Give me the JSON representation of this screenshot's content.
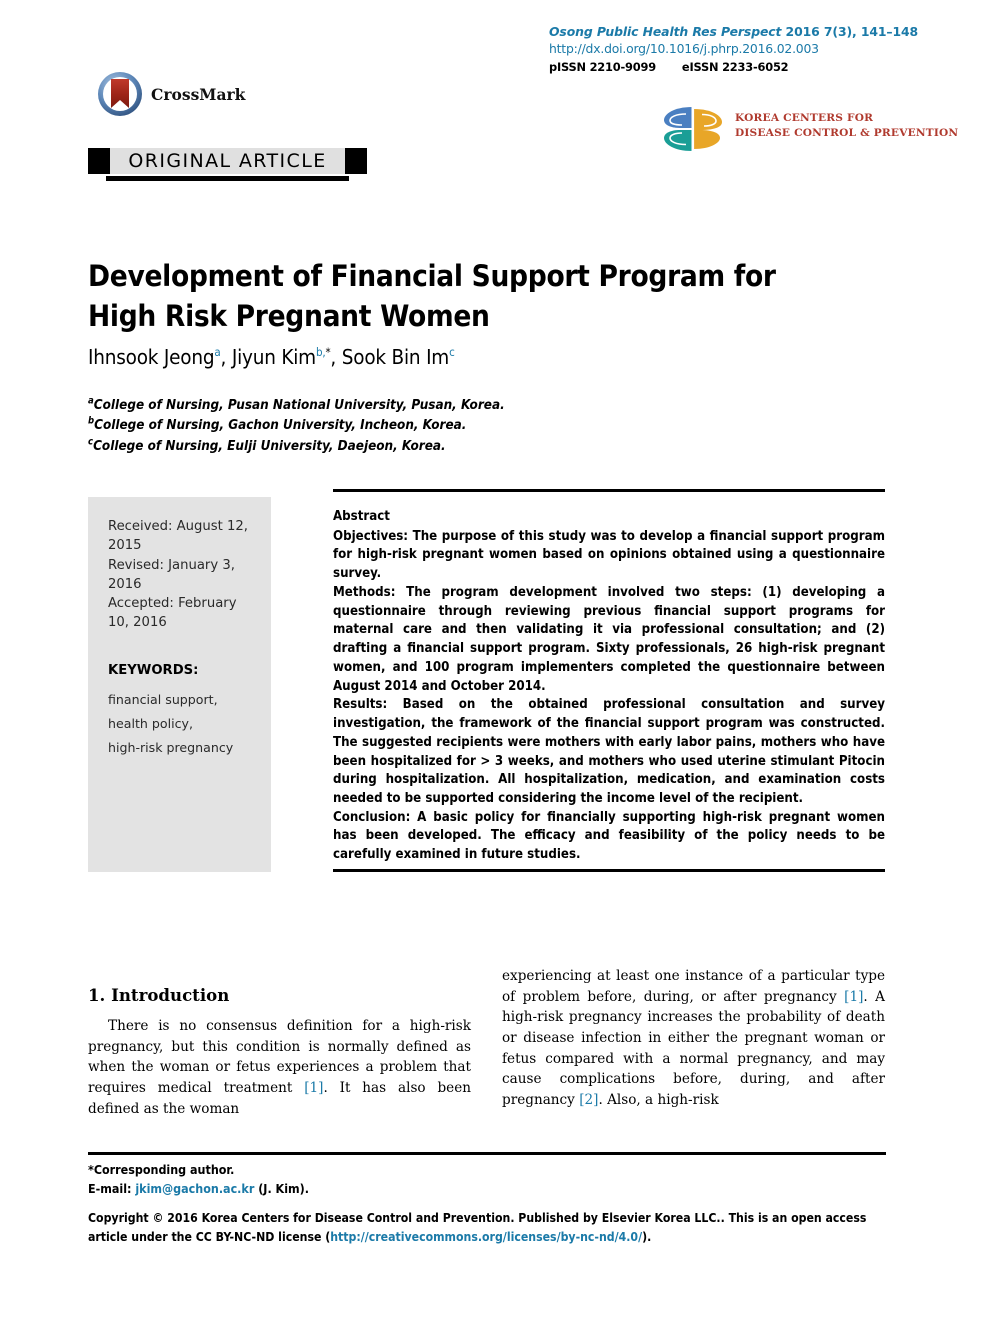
{
  "header": {
    "journal_citation_italic": "Osong Public Health Res Perspect",
    "journal_citation_vol": " 2016 7(3), 141–148",
    "doi_url": "http://dx.doi.org/10.1016/j.phrp.2016.02.003",
    "pissn": "pISSN 2210-9099",
    "eissn": "eISSN 2233-6052",
    "crossmark_label": "CrossMark",
    "kcdc_line1": "KOREA CENTERS FOR",
    "kcdc_line2": "DISEASE CONTROL & PREVENTION",
    "article_type_banner": "ORIGINAL ARTICLE"
  },
  "article": {
    "title_line1": "Development of Financial Support Program for",
    "title_line2": "High Risk Pregnant Women",
    "authors": [
      {
        "name": "Ihnsook Jeong",
        "sup": "a",
        "corresponding": false
      },
      {
        "name": "Jiyun Kim",
        "sup": "b,",
        "corresponding": true
      },
      {
        "name": "Sook Bin Im",
        "sup": "c",
        "corresponding": false
      }
    ],
    "affiliations": [
      {
        "marker": "a",
        "text": "College of Nursing, Pusan National University, Pusan, Korea."
      },
      {
        "marker": "b",
        "text": "College of Nursing, Gachon University, Incheon, Korea."
      },
      {
        "marker": "c",
        "text": "College of Nursing, Eulji University, Daejeon, Korea."
      }
    ]
  },
  "sidebar": {
    "received": "Received: August 12, 2015",
    "revised": "Revised: January 3, 2016",
    "accepted": "Accepted: February 10, 2016",
    "keywords_heading": "KEYWORDS:",
    "keywords": [
      "financial support,",
      "health policy,",
      "high-risk pregnancy"
    ]
  },
  "abstract": {
    "heading": "Abstract",
    "sections": [
      {
        "label": "Objectives:",
        "text": " The purpose of this study was to develop a financial support program for high-risk pregnant women based on opinions obtained using a questionnaire survey."
      },
      {
        "label": "Methods:",
        "text": " The program development involved two steps: (1) developing a questionnaire through reviewing previous financial support programs for maternal care and then validating it via professional consultation; and (2) drafting a financial support program. Sixty professionals, 26 high-risk pregnant women, and 100 program implementers completed the questionnaire between August 2014 and October 2014."
      },
      {
        "label": "Results:",
        "text": " Based on the obtained professional consultation and survey investigation, the framework of the financial support program was constructed. The suggested recipients were mothers with early labor pains, mothers who have been hospitalized for > 3 weeks, and mothers who used uterine stimulant Pitocin during hospitalization. All hospitalization, medication, and examination costs needed to be supported considering the income level of the recipient."
      },
      {
        "label": "Conclusion:",
        "text": " A basic policy for financially supporting high-risk pregnant women has been developed. The efficacy and feasibility of the policy needs to be carefully examined in future studies."
      }
    ]
  },
  "body": {
    "section_heading": "1. Introduction",
    "left_column_part1": "There is no consensus definition for a high-risk pregnancy, but this condition is normally defined as when the woman or fetus experiences a problem that requires medical treatment ",
    "left_cite_1": "[1]",
    "left_column_part2": ". It has also been defined as the woman",
    "right_column_part1": "experiencing at least one instance of a particular type of problem before, during, or after pregnancy ",
    "right_cite_1": "[1]",
    "right_column_part2": ". A high-risk pregnancy increases the probability of death or disease infection in either the pregnant woman or fetus compared with a normal pregnancy, and may cause complications before, during, and after pregnancy ",
    "right_cite_2": "[2]",
    "right_column_part3": ". Also, a high-risk"
  },
  "footer": {
    "corresponding_note": "*Corresponding author.",
    "email_label": "E-mail: ",
    "email": "jkim@gachon.ac.kr",
    "email_suffix": " (J. Kim).",
    "copyright_part1": "Copyright © 2016 Korea Centers for Disease Control and Prevention. Published by Elsevier Korea LLC.. This is an open access article under the CC BY-NC-ND license (",
    "license_url": "http://creativecommons.org/licenses/by-nc-nd/4.0/",
    "copyright_part2": ")."
  },
  "colors": {
    "link_blue": "#1b7aa8",
    "sidebar_gray": "#e3e3e3",
    "banner_gray": "#e0e0e0",
    "kcdc_red": "#b03a2e",
    "kcdc_blue": "#4a7fc1",
    "kcdc_teal": "#1a9e96",
    "kcdc_gold": "#e8a628"
  }
}
